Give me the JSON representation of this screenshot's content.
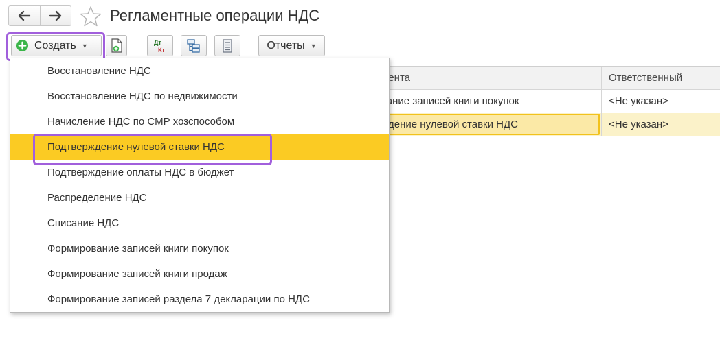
{
  "header": {
    "title": "Регламентные операции НДС",
    "back_icon": "arrow-left-icon",
    "forward_icon": "arrow-right-icon",
    "favorite_icon": "star-outline-icon"
  },
  "toolbar": {
    "create_label": "Создать",
    "reports_label": "Отчеты",
    "dtkt_dt": "Дт",
    "dtkt_kt": "Кт"
  },
  "table": {
    "columns": [
      "мента",
      "Ответственный"
    ],
    "rows": [
      {
        "operation": "вание записей книги покупок",
        "responsible": "<Не указан>"
      },
      {
        "operation": "ждение нулевой ставки НДС",
        "responsible": "<Не указан>"
      }
    ]
  },
  "menu": {
    "items": [
      "Восстановление НДС",
      "Восстановление НДС по недвижимости",
      "Начисление НДС по СМР хозспособом",
      "Подтверждение нулевой ставки НДС",
      "Подтверждение оплаты НДС в бюджет",
      "Распределение НДС",
      "Списание НДС",
      "Формирование записей книги покупок",
      "Формирование записей книги продаж",
      "Формирование записей раздела 7 декларации по НДС"
    ],
    "active_index": 3
  },
  "colors": {
    "highlight_frame": "#a15fdc",
    "active_item": "#fbcb23",
    "selected_row": "#fbf2c9",
    "create_icon": "#3bb54a"
  }
}
